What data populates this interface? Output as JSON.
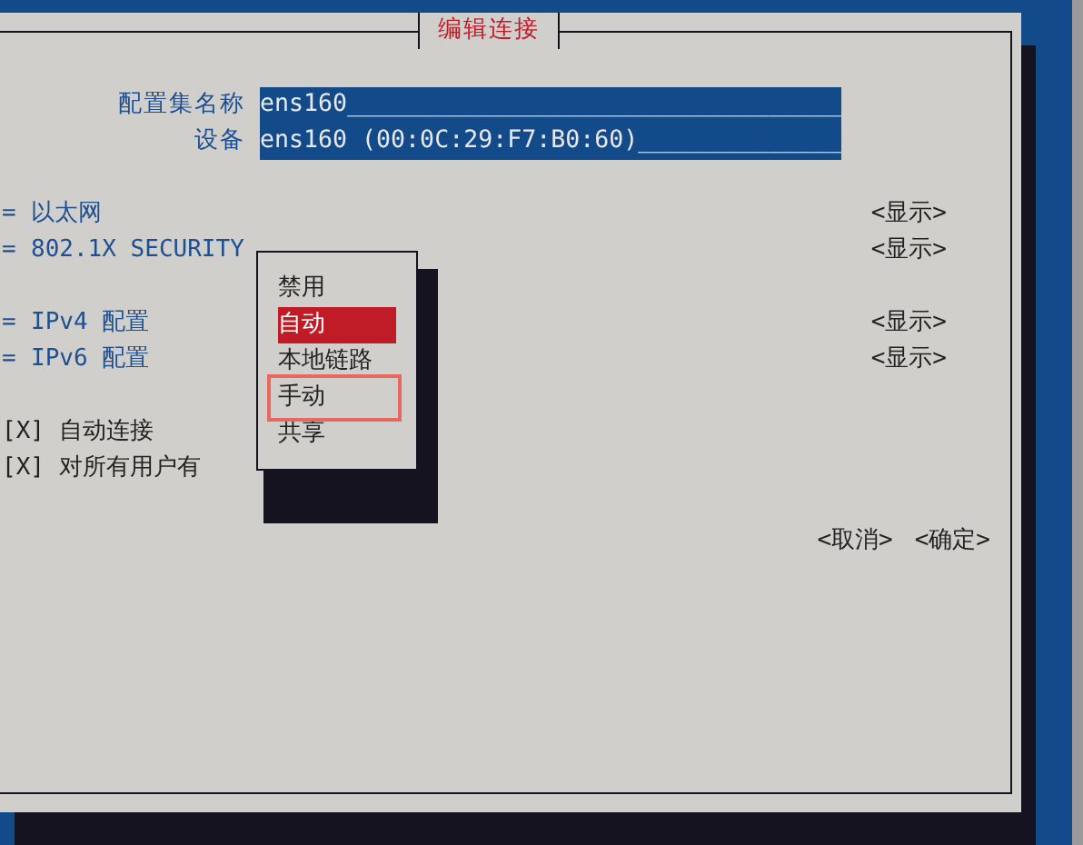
{
  "dialog": {
    "title": "编辑连接"
  },
  "fields": [
    {
      "label": "配置集名称",
      "value": "ens160__________________________________"
    },
    {
      "label": "设备",
      "value": "ens160 (00:0C:29:F7:B0:60)______________"
    }
  ],
  "section_groups": [
    [
      {
        "marker": "=",
        "label": "以太网",
        "action": "<显示>"
      },
      {
        "marker": "=",
        "label": "802.1X SECURITY",
        "action": "<显示>"
      }
    ],
    [
      {
        "marker": "=",
        "label": "IPv4 配置",
        "action": "<显示>"
      },
      {
        "marker": "=",
        "label": "IPv6 配置",
        "action": "<显示>"
      }
    ]
  ],
  "checkboxes": [
    {
      "box": "[X]",
      "label": "自动连接",
      "checked": true
    },
    {
      "box": "[X]",
      "label": "对所有用户有",
      "checked": true
    }
  ],
  "popup": {
    "items": [
      {
        "label": "禁用",
        "selected": false,
        "outlined": false
      },
      {
        "label": "自动",
        "selected": true,
        "outlined": false
      },
      {
        "label": "本地链路",
        "selected": false,
        "outlined": false
      },
      {
        "label": "手动",
        "selected": false,
        "outlined": true
      },
      {
        "label": "共享",
        "selected": false,
        "outlined": false
      }
    ]
  },
  "buttons": [
    "<取消>",
    "<确定>"
  ]
}
